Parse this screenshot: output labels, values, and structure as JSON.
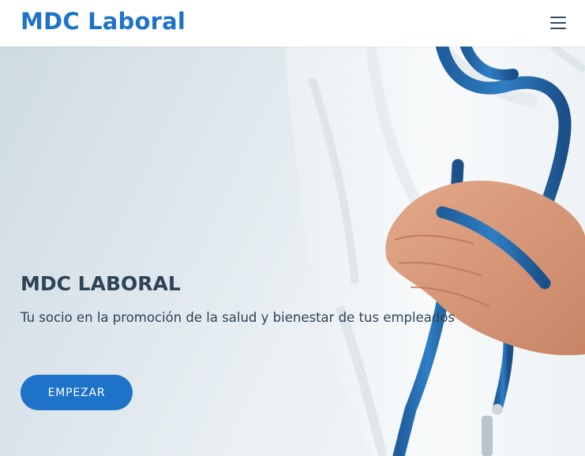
{
  "navbar": {
    "brand": "MDC Laboral",
    "menu_icon": "hamburger-menu-icon"
  },
  "hero": {
    "title": "MDC LABORAL",
    "subtitle": "Tu socio en la promoción de la salud y bienestar de tus empleados",
    "cta_label": "EMPEZAR",
    "background_image": "doctor-with-stethoscope"
  },
  "colors": {
    "brand": "#1e73c8",
    "text_dark": "#2f4356",
    "button_text": "#ffffff"
  }
}
